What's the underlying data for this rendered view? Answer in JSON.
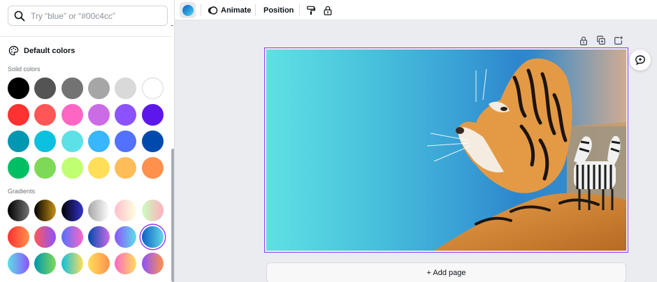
{
  "search": {
    "placeholder": "Try “blue” or “#00c4cc”"
  },
  "palette_panel": {
    "title": "Default colors",
    "solid_label": "Solid colors",
    "gradient_label": "Gradients",
    "solid_colors": [
      [
        "#000000",
        "#545454",
        "#737373",
        "#a6a6a6",
        "#d9d9d9",
        "#ffffff"
      ],
      [
        "#ff3131",
        "#ff5757",
        "#ff66c4",
        "#cb6ce6",
        "#8c52ff",
        "#5e17eb"
      ],
      [
        "#0097b2",
        "#0cc0df",
        "#5ce1e6",
        "#38b6ff",
        "#5271ff",
        "#004aad"
      ],
      [
        "#00bf63",
        "#7ed957",
        "#c1ff72",
        "#ffde59",
        "#ffbd59",
        "#ff914d"
      ]
    ],
    "gradients": [
      [
        [
          "#000000",
          "#737373"
        ],
        [
          "#000000",
          "#c89116"
        ],
        [
          "#000000",
          "#3533cd"
        ],
        [
          "#a6a6a6",
          "#ffffff"
        ],
        [
          "#ffc0cb",
          "#ffffe0"
        ],
        [
          "#c9ffbf",
          "#ffafbd"
        ]
      ],
      [
        [
          "#ff3131",
          "#ff914d"
        ],
        [
          "#ff5757",
          "#8c52ff"
        ],
        [
          "#5170ff",
          "#ff66c4"
        ],
        [
          "#004aad",
          "#cb6ce6"
        ],
        [
          "#8c52ff",
          "#5ce1e6"
        ],
        [
          "#0b63c4",
          "#64d6e8"
        ]
      ],
      [
        [
          "#5de0e6",
          "#8c52ff"
        ],
        [
          "#0097b2",
          "#7ed957"
        ],
        [
          "#0cc0df",
          "#ffde59"
        ],
        [
          "#ffde59",
          "#ff914d"
        ],
        [
          "#ff66c4",
          "#ffde59"
        ],
        [
          "#8c52ff",
          "#ff914d"
        ]
      ]
    ],
    "selected_gradient": [
      1,
      5
    ]
  },
  "toolbar": {
    "animate_label": "Animate",
    "position_label": "Position"
  },
  "canvas": {
    "add_page_label": "+ Add page",
    "accent": "#8b3dff"
  },
  "icons": {
    "search": "search-icon",
    "palette": "palette-icon",
    "animate": "animate-icon",
    "paint_format": "paint-roller-icon",
    "lock": "lock-icon",
    "duplicate": "duplicate-icon",
    "add_page": "add-page-icon",
    "comment": "comment-icon"
  }
}
